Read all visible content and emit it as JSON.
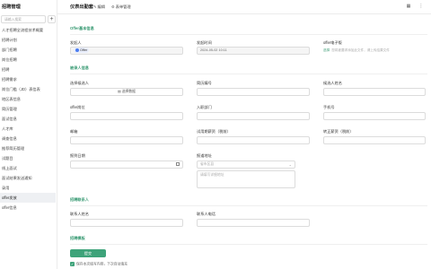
{
  "sidebar": {
    "title": "招聘管理",
    "search_placeholder": "请输入搜索",
    "add_label": "+",
    "items": [
      {
        "label": "人才招聘全流程技术概要",
        "active": false
      },
      {
        "label": "招聘计划",
        "active": false
      },
      {
        "label": "部门招聘",
        "active": false
      },
      {
        "label": "岗位招聘",
        "active": false
      },
      {
        "label": "招聘",
        "active": false
      },
      {
        "label": "招聘需求",
        "active": false
      },
      {
        "label": "岗位门槛（JD）表信表",
        "active": false
      },
      {
        "label": "地区表信息",
        "active": false
      },
      {
        "label": "简历管理",
        "active": false
      },
      {
        "label": "面试信息",
        "active": false
      },
      {
        "label": "人才库",
        "active": false
      },
      {
        "label": "调查信息",
        "active": false
      },
      {
        "label": "推荐简历管理",
        "active": false
      },
      {
        "label": "试题目",
        "active": false
      },
      {
        "label": "线上面试",
        "active": false
      },
      {
        "label": "面试结果发送通知",
        "active": false
      },
      {
        "label": "录用",
        "active": false
      },
      {
        "label": "offer发放",
        "active": true
      },
      {
        "label": "offer信息",
        "active": false
      }
    ]
  },
  "topbar": {
    "title": "仪表出勤套",
    "edit_label": "编辑",
    "manage_label": "表单管理"
  },
  "sections": {
    "basic": "Offer基本信息",
    "candidate": "被录人信息",
    "contact": "招聘联系人",
    "other": "招聘模板"
  },
  "fields": {
    "issuer_label": "发起人",
    "issuer_value": "Offer",
    "issue_time_label": "发起时间",
    "issue_time_value": "2024-05-02 10:11",
    "offer_email_label": "offer电子版",
    "offer_email_select": "选择",
    "offer_email_hint": "您将被要求添加此文件，请上传结果文件",
    "select_candidate_label": "选择候选人",
    "select_candidate_btn": "选择数据",
    "app_no_label": "简历编号",
    "candidate_name_label": "候选人姓名",
    "offer_position_label": "offer岗位",
    "dept_label": "入职部门",
    "phone_label": "手机号",
    "email_label": "邮箱",
    "trial_salary_label": "试用期薪资（税前）",
    "regular_salary_label": "转正薪资（税前）",
    "report_date_label": "报到日期",
    "report_addr_label": "报道地址",
    "province_placeholder": "省市区县",
    "detail_addr_placeholder": "请填写详细地址",
    "contact_name_label": "联系人姓名",
    "contact_phone_label": "联系人电话"
  },
  "footer": {
    "submit_label": "提交",
    "save_hint": "保存本次填写内容，下次自动填充"
  }
}
